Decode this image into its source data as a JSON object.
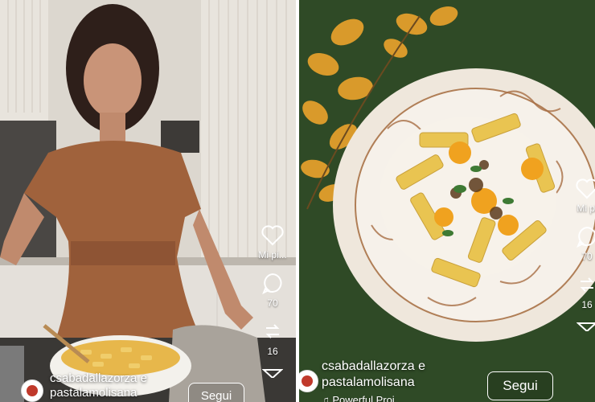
{
  "left_reel": {
    "author_line1": "csabadallazorza e",
    "author_line2": "pastalamolisana",
    "follow_label": "Segui",
    "like_label": "Mi pi...",
    "comment_count": "70",
    "share_count": "16",
    "icons": [
      "heart-icon",
      "comment-icon",
      "share-icon",
      "send-icon"
    ]
  },
  "right_reel": {
    "author_line1": "csabadallazorza e",
    "author_line2": "pastalamolisana",
    "follow_label": "Segui",
    "like_label": "Mi pi",
    "comment_count": "70",
    "share_count": "16",
    "audio_label": "Powerful Proj...",
    "icons": [
      "heart-icon",
      "comment-icon",
      "share-icon",
      "send-icon"
    ]
  },
  "colors": {
    "kitchen_wall": "#d9d4cc",
    "dress": "#a0623c",
    "tablecloth": "#2f4a26",
    "leaves": "#d99a2b",
    "pasta": "#e9c451"
  }
}
